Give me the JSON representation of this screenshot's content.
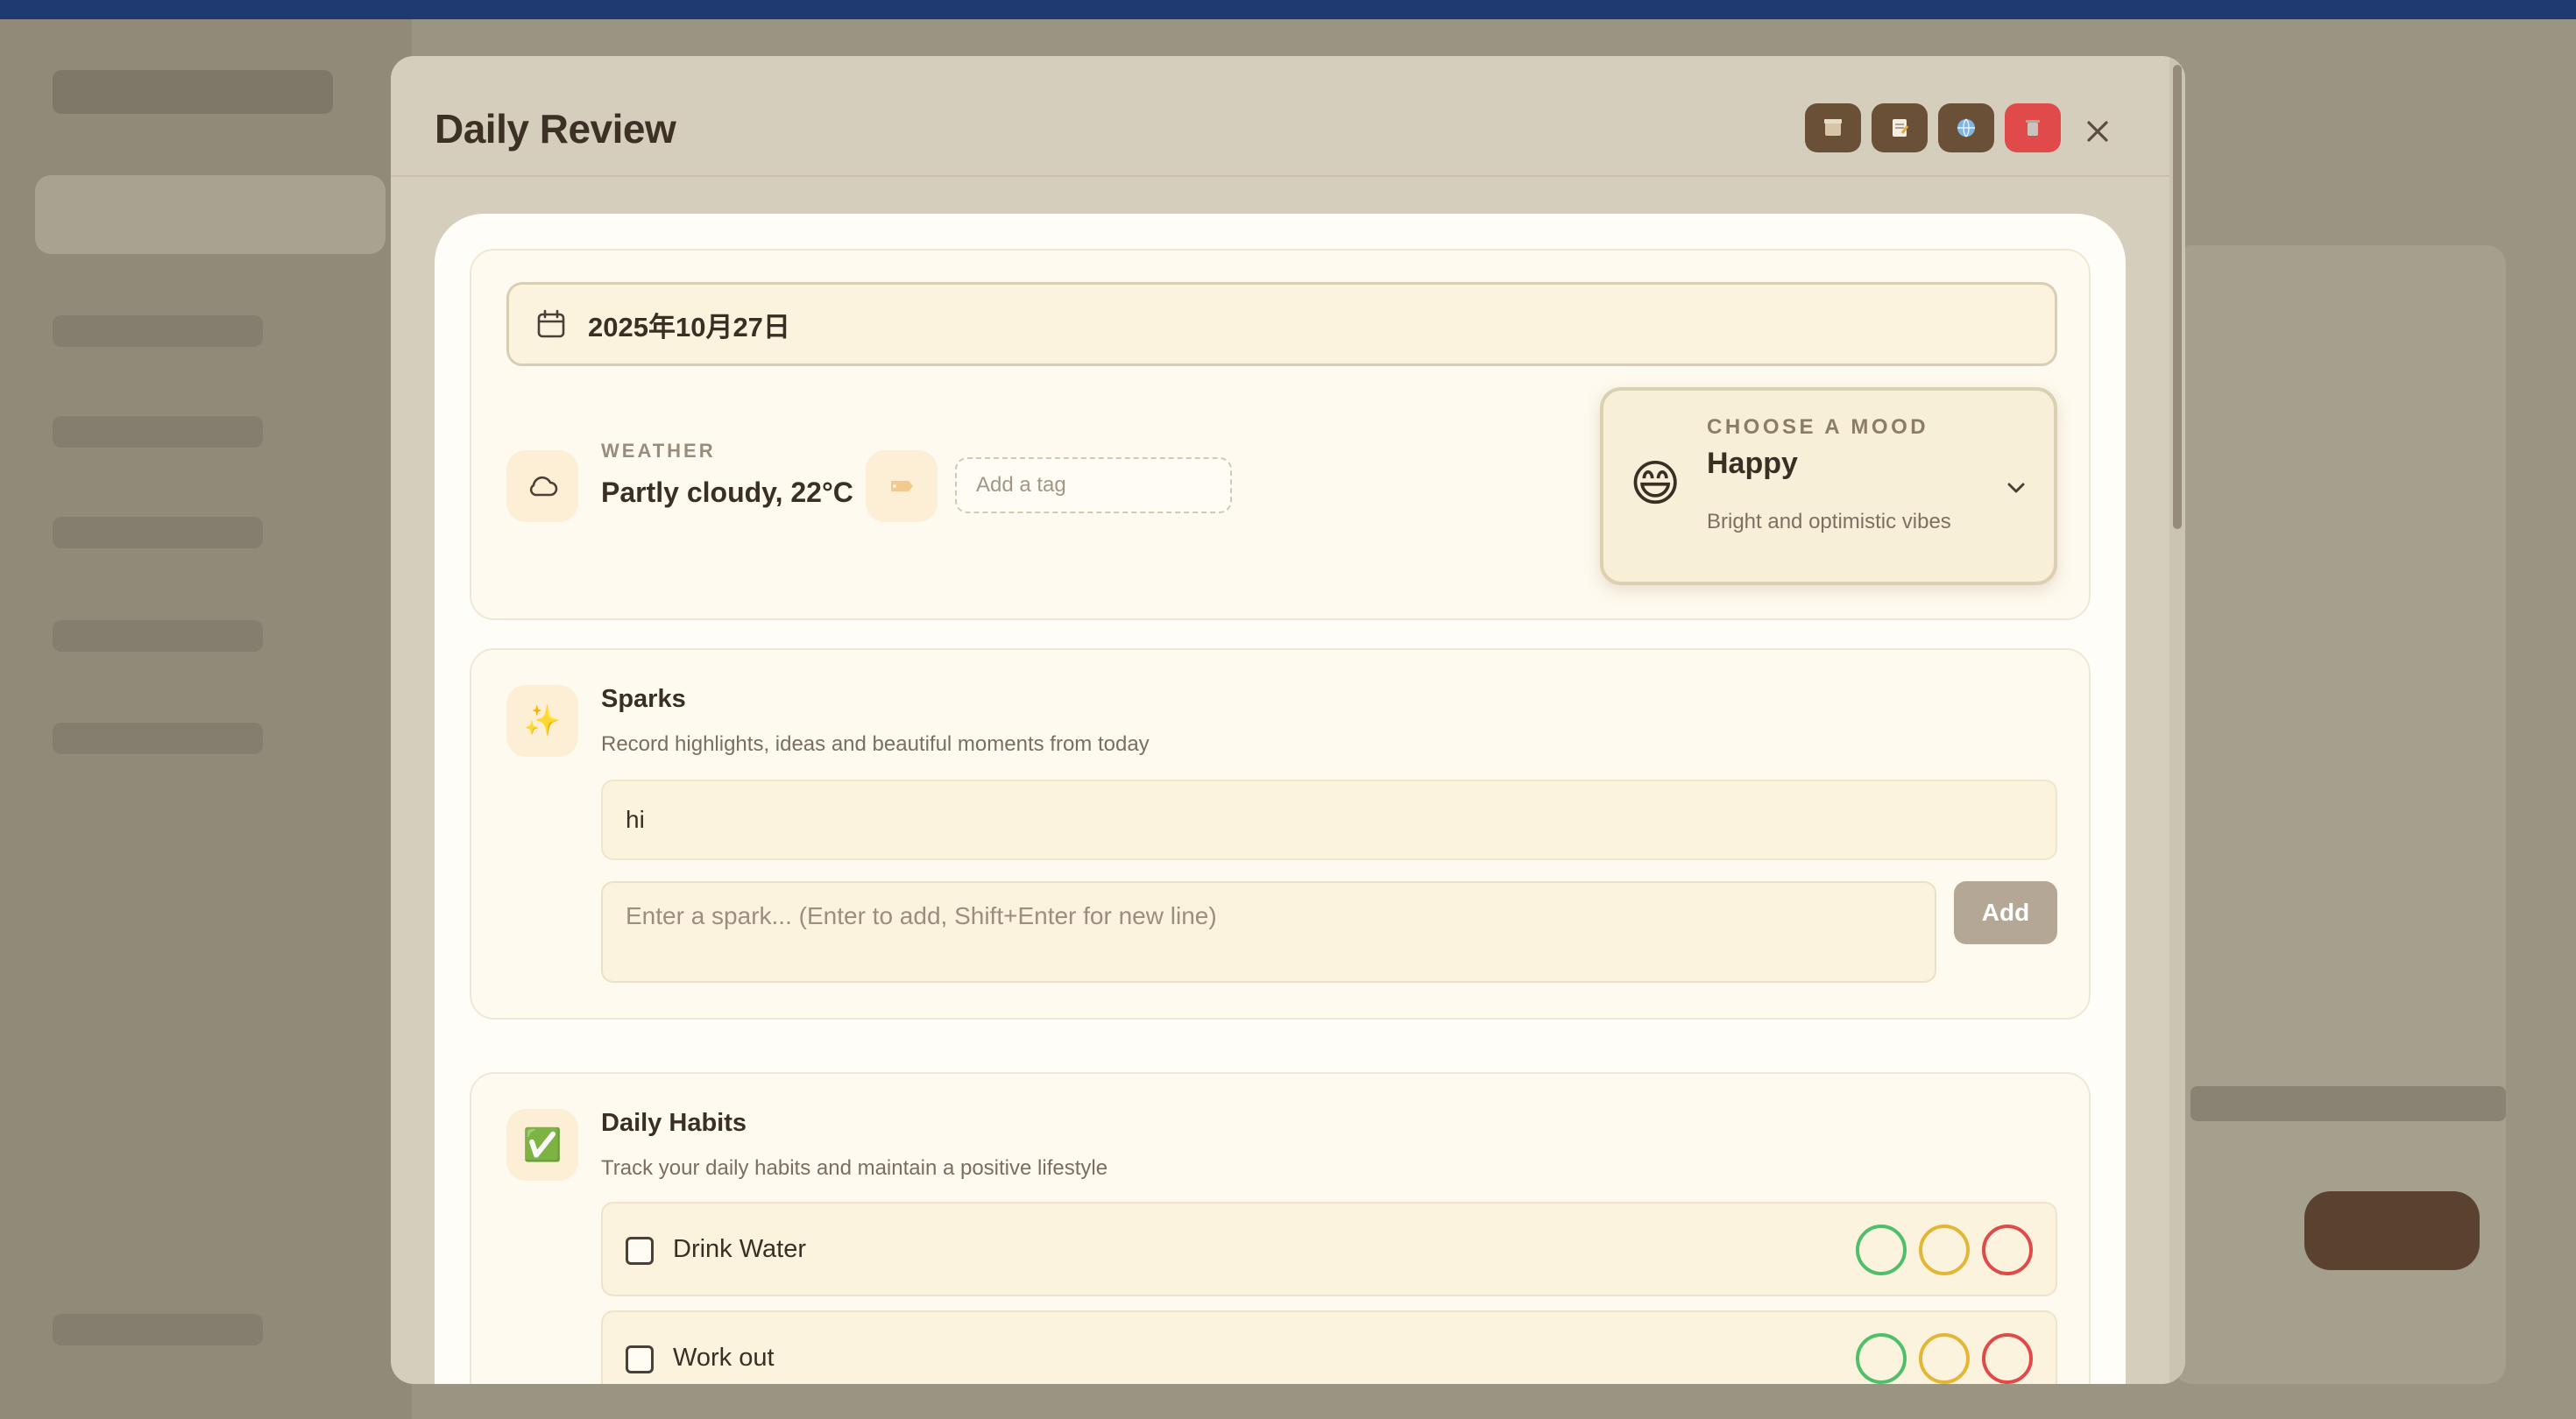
{
  "modal": {
    "title": "Daily Review",
    "toolbar": {
      "icons": [
        "archive-icon",
        "note-icon",
        "globe-icon",
        "trash-icon"
      ],
      "close_icon": "close-icon"
    }
  },
  "overview": {
    "date": "2025年10月27日",
    "weather": {
      "label": "WEATHER",
      "value": "Partly cloudy, 22°C",
      "icon": "cloud-icon"
    },
    "tag": {
      "icon": "tag-icon",
      "placeholder": "Add a tag"
    },
    "mood": {
      "label": "CHOOSE A MOOD",
      "emoji": "😄",
      "name": "Happy",
      "description": "Bright and optimistic vibes"
    }
  },
  "sparks": {
    "icon": "✨",
    "title": "Sparks",
    "subtitle": "Record highlights, ideas and beautiful moments from today",
    "items": [
      "hi"
    ],
    "input_placeholder": "Enter a spark... (Enter to add, Shift+Enter for new line)",
    "add_label": "Add"
  },
  "habits": {
    "icon": "✅",
    "title": "Daily Habits",
    "subtitle": "Track your daily habits and maintain a positive lifestyle",
    "items": [
      {
        "label": "Drink Water",
        "checked": false
      },
      {
        "label": "Work out",
        "checked": false
      }
    ],
    "status_colors": {
      "green": "#4fbf6a",
      "yellow": "#e3b635",
      "red": "#e04a4a"
    }
  },
  "colors": {
    "accent_brown": "#6b5038",
    "danger": "#e04a4a"
  }
}
